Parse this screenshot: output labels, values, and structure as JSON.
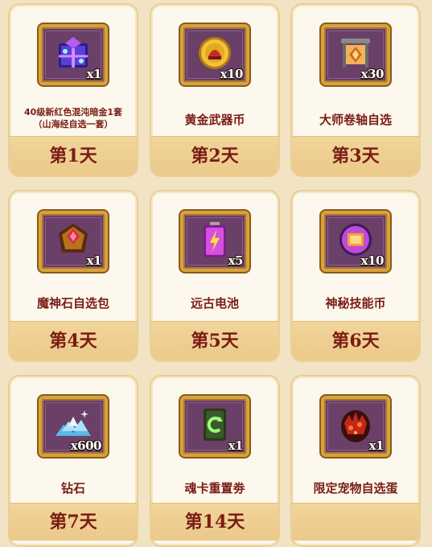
{
  "rewards": [
    {
      "name_line1": "40级新红色混沌暗金1套",
      "name_line2": "（山海经自选一套）",
      "qty": "x1",
      "day": "第1天",
      "icon": "chaos-gear-chest-icon"
    },
    {
      "name_line1": "黄金武器币",
      "name_line2": "",
      "qty": "x10",
      "day": "第2天",
      "icon": "gold-weapon-coin-icon"
    },
    {
      "name_line1": "大师卷轴自选",
      "name_line2": "",
      "qty": "x30",
      "day": "第3天",
      "icon": "master-scroll-icon"
    },
    {
      "name_line1": "魔神石自选包",
      "name_line2": "",
      "qty": "x1",
      "day": "第4天",
      "icon": "demon-stone-pack-icon"
    },
    {
      "name_line1": "远古电池",
      "name_line2": "",
      "qty": "x5",
      "day": "第5天",
      "icon": "ancient-battery-icon"
    },
    {
      "name_line1": "神秘技能币",
      "name_line2": "",
      "qty": "x10",
      "day": "第6天",
      "icon": "skill-coin-icon"
    },
    {
      "name_line1": "钻石",
      "name_line2": "",
      "qty": "x600",
      "day": "第7天",
      "icon": "diamond-icon"
    },
    {
      "name_line1": "魂卡重置劵",
      "name_line2": "",
      "qty": "x1",
      "day": "第14天",
      "icon": "soul-card-reset-icon"
    },
    {
      "name_line1": "限定宠物自选蛋",
      "name_line2": "",
      "qty": "x1",
      "day": "",
      "icon": "pet-egg-icon"
    }
  ],
  "colors": {
    "card_bg": "#fcf8ee",
    "day_bar": "#ebc98a",
    "text_red": "#7a1c14",
    "frame_purple": "#6a3f68",
    "frame_gold": "#d8a23a"
  }
}
